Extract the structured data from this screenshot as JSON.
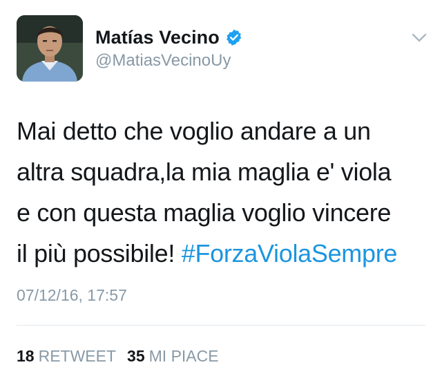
{
  "user": {
    "display_name": "Matías Vecino",
    "handle": "@MatiasVecinoUy",
    "verified": true,
    "avatar_icon": "user-avatar"
  },
  "tweet": {
    "text_lines": [
      "Mai detto che voglio andare a un",
      "altra squadra,la mia maglia e' viola",
      "e con questa maglia voglio vincere"
    ],
    "last_line_text": "il più possibile! ",
    "hashtag": "#ForzaViolaSempre",
    "timestamp": "07/12/16, 17:57"
  },
  "stats": {
    "retweets_count": "18",
    "retweets_label": "RETWEET",
    "likes_count": "35",
    "likes_label": "MI PIACE"
  },
  "colors": {
    "link": "#1b95e0",
    "muted": "#8899a6",
    "text": "#14171a",
    "verified": "#1da1f2"
  },
  "icons": {
    "verified": "verified-badge-icon",
    "menu": "chevron-down-icon"
  }
}
